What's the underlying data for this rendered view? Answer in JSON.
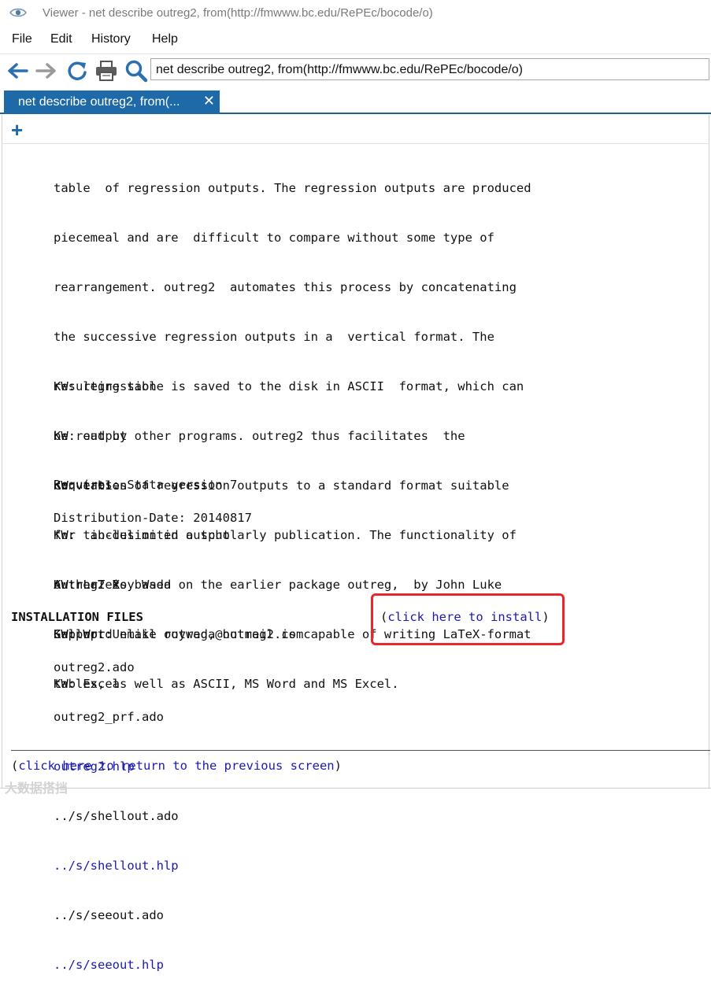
{
  "window": {
    "title": "Viewer - net describe outreg2, from(http://fmwww.bc.edu/RePEc/bocode/o)"
  },
  "menu": [
    "File",
    "Edit",
    "History",
    "Help"
  ],
  "toolbar": {
    "icons": [
      "back-arrow-icon",
      "forward-arrow-icon",
      "refresh-icon",
      "print-icon",
      "search-icon"
    ],
    "command": "net describe outreg2, from(http://fmwww.bc.edu/RePEc/bocode/o)"
  },
  "tab": {
    "label": "net describe outreg2, from(...",
    "close": "✕"
  },
  "plus": "+",
  "description_lines": [
    "table  of regression outputs. The regression outputs are produced",
    "piecemeal and are  difficult to compare without some type of",
    "rearrangement. outreg2  automates this process by concatenating",
    "the successive regression outputs in a  vertical format. The",
    "resulting table is saved to the disk in ASCII  format, which can",
    "be read by other programs. outreg2 thus facilitates  the",
    "convertion of regression outputs to a standard format suitable",
    "for  inclusion in a scholarly publication. The functionality of",
    "outreg2 is based on the earlier package outreg,  by John Luke",
    "Gallup. Unlike outreg, outreg2 is capable of writing LaTeX-format",
    "tables, as well as ASCII, MS Word and MS Excel."
  ],
  "keywords": [
    "KW: regression",
    "KW: output",
    "KW: tables",
    "KW: tab-delimited output",
    "KW: LaTeX",
    "KW: Word",
    "KW: Excel"
  ],
  "requires": "Requires: Stata version 7",
  "distribution_date": "Distribution-Date: 20140817",
  "author": "Author: Roy Wada",
  "support": "Support: email roywada@hotmail.com",
  "installation": {
    "heading": "INSTALLATION FILES",
    "install_open": "(",
    "install_link": "click here to install",
    "install_close": ")",
    "files": [
      {
        "name": "outreg2.ado",
        "link": false
      },
      {
        "name": "outreg2_prf.ado",
        "link": false
      },
      {
        "name": "outreg2.hlp",
        "link": true
      },
      {
        "name": "../s/shellout.ado",
        "link": false
      },
      {
        "name": "../s/shellout.hlp",
        "link": true
      },
      {
        "name": "../s/seeout.ado",
        "link": false
      },
      {
        "name": "../s/seeout.hlp",
        "link": true
      }
    ]
  },
  "back": {
    "open": "(",
    "link": "click here to return to the previous screen",
    "close": ")"
  },
  "watermark": "大数据搭挡",
  "colors": {
    "accent": "#1e6aa8",
    "link": "#1a1ab4",
    "highlight": "#e8262c"
  }
}
